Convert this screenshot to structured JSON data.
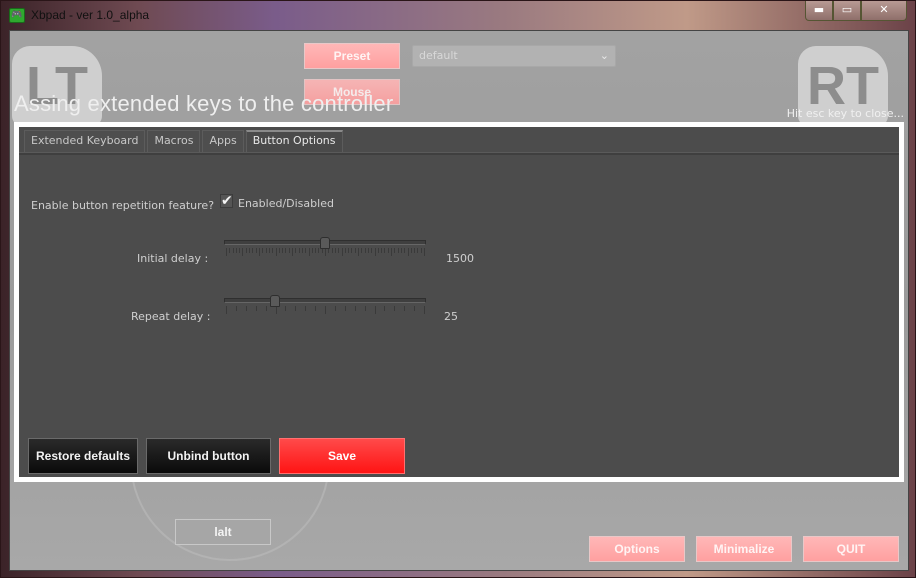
{
  "window": {
    "title": "Xbpad - ver 1.0_alpha",
    "app_icon_glyph": "🎮",
    "controls": {
      "minimize": "▬",
      "maximize": "▭",
      "close": "✕"
    }
  },
  "background": {
    "left_trigger": "LT",
    "right_trigger": "RT"
  },
  "top": {
    "preset_label": "Preset",
    "mouse_label": "Mouse",
    "preset_select_value": "default",
    "chevron": "⌄"
  },
  "heading": "Assing extended keys to the controller",
  "hint": "Hit esc key to close...",
  "tabs": [
    {
      "label": "Extended Keyboard",
      "active": false
    },
    {
      "label": "Macros",
      "active": false
    },
    {
      "label": "Apps",
      "active": false
    },
    {
      "label": "Button Options",
      "active": true
    }
  ],
  "options": {
    "enable_label": "Enable button repetition feature?",
    "checkbox_checked": true,
    "checkbox_glyph": "✔",
    "checkbox_label": "Enabled/Disabled",
    "initial_delay": {
      "label": "Initial delay :",
      "value": "1500",
      "position": 0.5,
      "tick_count": 61
    },
    "repeat_delay": {
      "label": "Repeat delay :",
      "value": "25",
      "position": 0.25,
      "tick_count": 21
    }
  },
  "actions": {
    "restore": "Restore defaults",
    "unbind": "Unbind button",
    "save": "Save"
  },
  "bottom": {
    "lalt": "lalt",
    "options": "Options",
    "minimize": "Minimalize",
    "quit": "QUIT"
  }
}
